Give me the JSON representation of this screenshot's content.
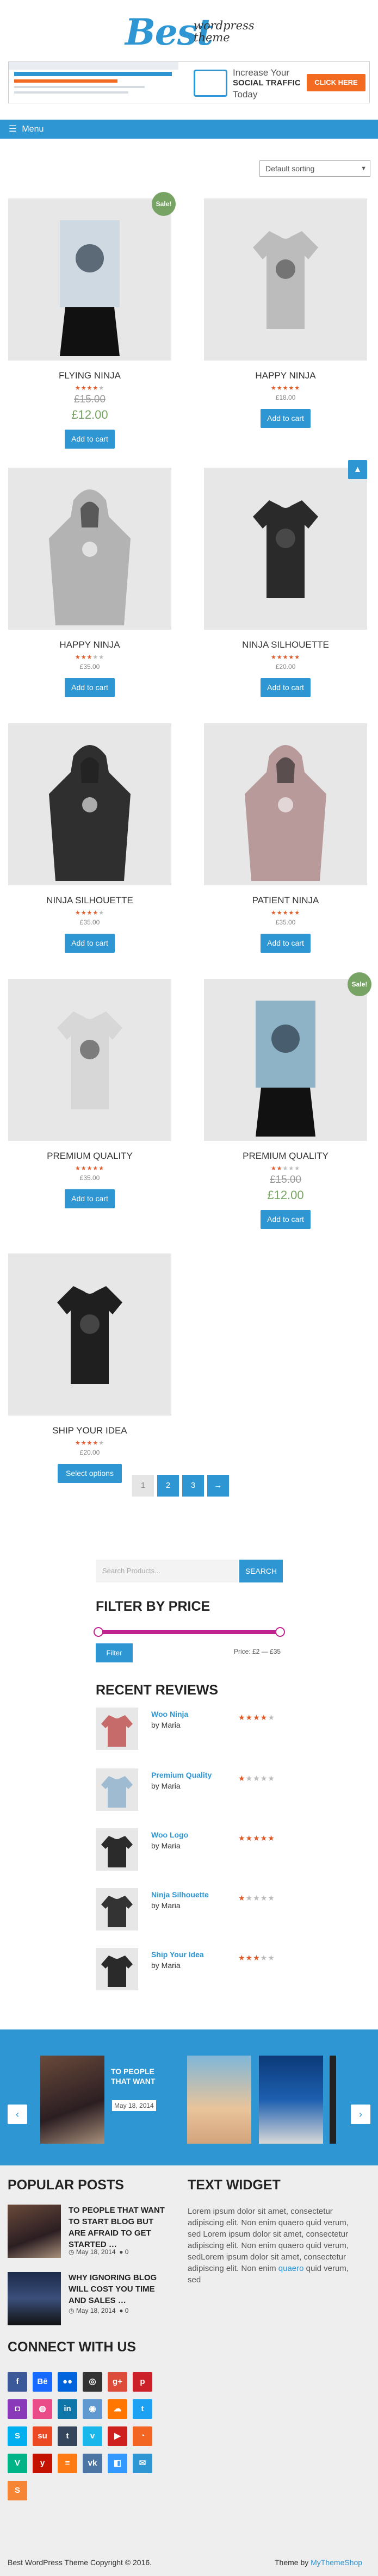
{
  "header": {
    "logo_main": "Best",
    "logo_sub": "wordpress theme"
  },
  "ad": {
    "line1": "Increase Your",
    "line2": "SOCIAL TRAFFIC",
    "line3": "Today",
    "button": "CLICK HERE"
  },
  "nav": {
    "menu_label": "Menu",
    "menu_icon": "hamburger-icon"
  },
  "sorting": {
    "selected": "Default sorting"
  },
  "products": [
    {
      "name": "FLYING NINJA",
      "rating": 4,
      "old_price": "£15.00",
      "price": "£12.00",
      "sale": true,
      "sale_label": "Sale!",
      "button": "Add to cart"
    },
    {
      "name": "HAPPY NINJA",
      "rating": 5,
      "price": "£18.00",
      "sale": false,
      "button": "Add to cart"
    },
    {
      "name": "HAPPY NINJA",
      "rating": 3,
      "price": "£35.00",
      "sale": false,
      "button": "Add to cart"
    },
    {
      "name": "NINJA SILHOUETTE",
      "rating": 5,
      "price": "£20.00",
      "sale": false,
      "button": "Add to cart"
    },
    {
      "name": "NINJA SILHOUETTE",
      "rating": 4,
      "price": "£35.00",
      "sale": false,
      "button": "Add to cart"
    },
    {
      "name": "PATIENT NINJA",
      "rating": 5,
      "price": "£35.00",
      "sale": false,
      "button": "Add to cart"
    },
    {
      "name": "PREMIUM QUALITY",
      "rating": 5,
      "price": "£35.00",
      "sale": false,
      "button": "Add to cart"
    },
    {
      "name": "PREMIUM QUALITY",
      "rating": 2,
      "old_price": "£15.00",
      "price": "£12.00",
      "sale": true,
      "sale_label": "Sale!",
      "button": "Add to cart"
    },
    {
      "name": "SHIP YOUR IDEA",
      "rating": 4,
      "price": "£20.00",
      "sale": false,
      "button": "Select options"
    }
  ],
  "pagination": {
    "pages": [
      "1",
      "2",
      "3",
      "→"
    ],
    "current": "1"
  },
  "search": {
    "placeholder": "Search Products...",
    "button": "SEARCH"
  },
  "filter": {
    "title": "FILTER BY PRICE",
    "button": "Filter",
    "range_text": "Price: £2 — £35"
  },
  "reviews": {
    "title": "RECENT REVIEWS",
    "items": [
      {
        "product": "Woo Ninja",
        "by": "by Maria",
        "rating": 4
      },
      {
        "product": "Premium Quality",
        "by": "by Maria",
        "rating": 1
      },
      {
        "product": "Woo Logo",
        "by": "by Maria",
        "rating": 5
      },
      {
        "product": "Ninja Silhouette",
        "by": "by Maria",
        "rating": 1
      },
      {
        "product": "Ship Your Idea",
        "by": "by Maria",
        "rating": 3
      }
    ]
  },
  "carousel": {
    "caption": "TO PEOPLE THAT WANT",
    "date": "May 18, 2014",
    "prev": "‹",
    "next": "›"
  },
  "popular_posts": {
    "title": "POPULAR POSTS",
    "items": [
      {
        "title": "TO PEOPLE THAT WANT TO START BLOG BUT ARE AFRAID TO GET STARTED …",
        "date": "May 18, 2014",
        "comments": "0"
      },
      {
        "title": "WHY IGNORING BLOG WILL COST YOU TIME AND SALES …",
        "date": "May 18, 2014",
        "comments": "0"
      }
    ]
  },
  "text_widget": {
    "title": "TEXT WIDGET",
    "body": "Lorem ipsum dolor sit amet, consectetur adipiscing elit. Non enim quaero quid verum, sed Lorem ipsum dolor sit amet, consectetur adipiscing elit. Non enim quaero quid verum, sedLorem ipsum dolor sit amet, consectetur adipiscing elit. Non enim",
    "link": "quaero",
    "tail": " quid verum, sed"
  },
  "connect": {
    "title": "CONNECT WITH US",
    "icons": [
      {
        "name": "facebook-icon",
        "glyph": "f",
        "color": "#3b5998"
      },
      {
        "name": "behance-icon",
        "glyph": "Bē",
        "color": "#1769ff"
      },
      {
        "name": "flickr-icon",
        "glyph": "●●",
        "color": "#0063dc"
      },
      {
        "name": "github-icon",
        "glyph": "◎",
        "color": "#333333"
      },
      {
        "name": "google-plus-icon",
        "glyph": "g+",
        "color": "#dd4b39"
      },
      {
        "name": "pinterest-icon",
        "glyph": "p",
        "color": "#cb2027"
      },
      {
        "name": "instagram-icon",
        "glyph": "◘",
        "color": "#8a3ab9"
      },
      {
        "name": "dribbble-icon",
        "glyph": "◍",
        "color": "#ea4c89"
      },
      {
        "name": "linkedin-icon",
        "glyph": "in",
        "color": "#0e76a8"
      },
      {
        "name": "reddit-icon",
        "glyph": "◉",
        "color": "#5f99cf"
      },
      {
        "name": "soundcloud-icon",
        "glyph": "☁",
        "color": "#ff7700"
      },
      {
        "name": "twitter-icon",
        "glyph": "t",
        "color": "#1da1f2"
      },
      {
        "name": "skype-icon",
        "glyph": "S",
        "color": "#00aff0"
      },
      {
        "name": "stumbleupon-icon",
        "glyph": "su",
        "color": "#eb4924"
      },
      {
        "name": "tumblr-icon",
        "glyph": "t",
        "color": "#35465c"
      },
      {
        "name": "vimeo-icon",
        "glyph": "v",
        "color": "#1ab7ea"
      },
      {
        "name": "youtube-icon",
        "glyph": "▶",
        "color": "#cd201f"
      },
      {
        "name": "rss-icon",
        "glyph": "◔",
        "color": "#f26522"
      },
      {
        "name": "vine-icon",
        "glyph": "V",
        "color": "#00b488"
      },
      {
        "name": "yelp-icon",
        "glyph": "y",
        "color": "#c41200"
      },
      {
        "name": "stackoverflow-icon",
        "glyph": "≡",
        "color": "#fe7a15"
      },
      {
        "name": "vk-icon",
        "glyph": "vk",
        "color": "#4c75a3"
      },
      {
        "name": "delicious-icon",
        "glyph": "◧",
        "color": "#3399ff"
      },
      {
        "name": "email-icon",
        "glyph": "✉",
        "color": "#2d96d3"
      },
      {
        "name": "stack-exchange-icon",
        "glyph": "S",
        "color": "#f68536"
      }
    ]
  },
  "footer": {
    "copyright": "Best WordPress Theme Copyright © 2016.",
    "theme_prefix": "Theme by ",
    "theme_link": "MyThemeShop"
  }
}
